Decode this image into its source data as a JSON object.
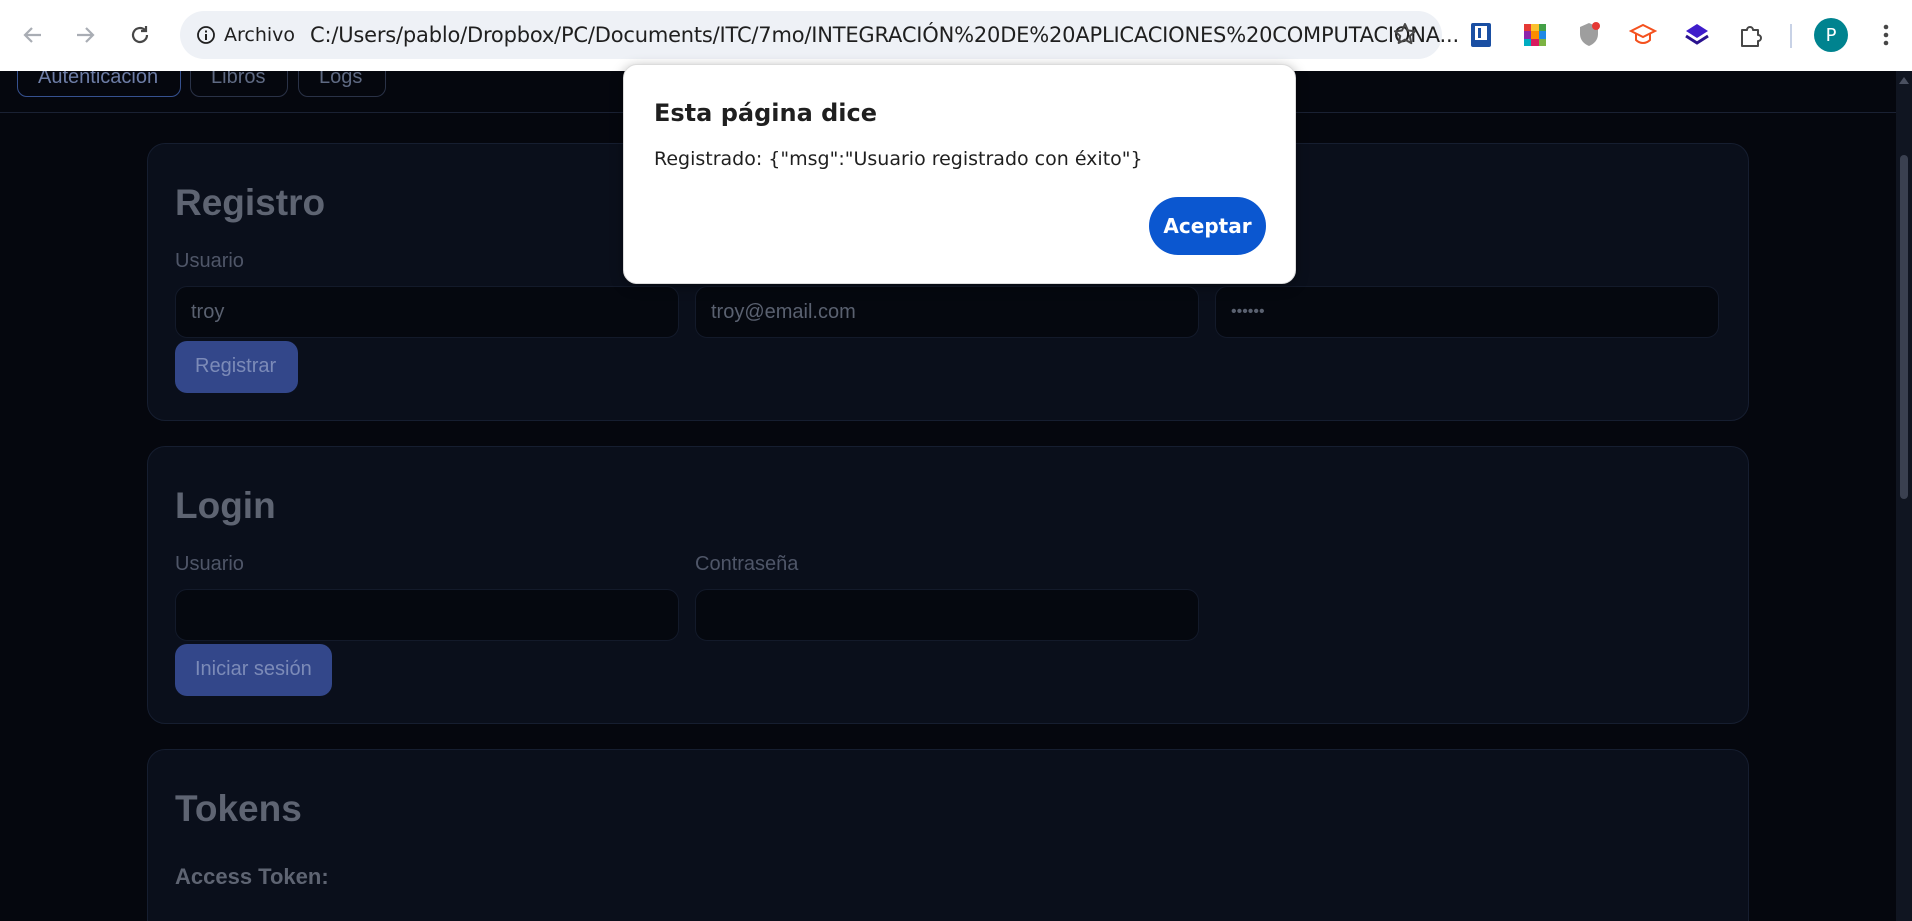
{
  "browser": {
    "site_info_label": "Archivo",
    "url": "C:/Users/pablo/Dropbox/PC/Documents/ITC/7mo/INTEGRACIÓN%20DE%20APLICACIONES%20COMPUTACIONA...",
    "profile_initial": "P",
    "accent_color": "#0b57d0"
  },
  "tabs": [
    {
      "label": "Autenticación"
    },
    {
      "label": "Libros"
    },
    {
      "label": "Logs"
    }
  ],
  "registro": {
    "title": "Registro",
    "usuario_label": "Usuario",
    "usuario_value": "troy",
    "email_value": "troy@email.com",
    "password_label_partial": "ña",
    "password_value": "••••••",
    "submit_label": "Registrar"
  },
  "login": {
    "title": "Login",
    "usuario_label": "Usuario",
    "password_label": "Contraseña",
    "usuario_value": "",
    "password_value": "",
    "submit_label": "Iniciar sesión"
  },
  "tokens": {
    "title": "Tokens",
    "access_token_label": "Access Token:"
  },
  "dialog": {
    "title": "Esta página dice",
    "message": "Registrado: {\"msg\":\"Usuario registrado con éxito\"}",
    "ok_label": "Aceptar"
  }
}
